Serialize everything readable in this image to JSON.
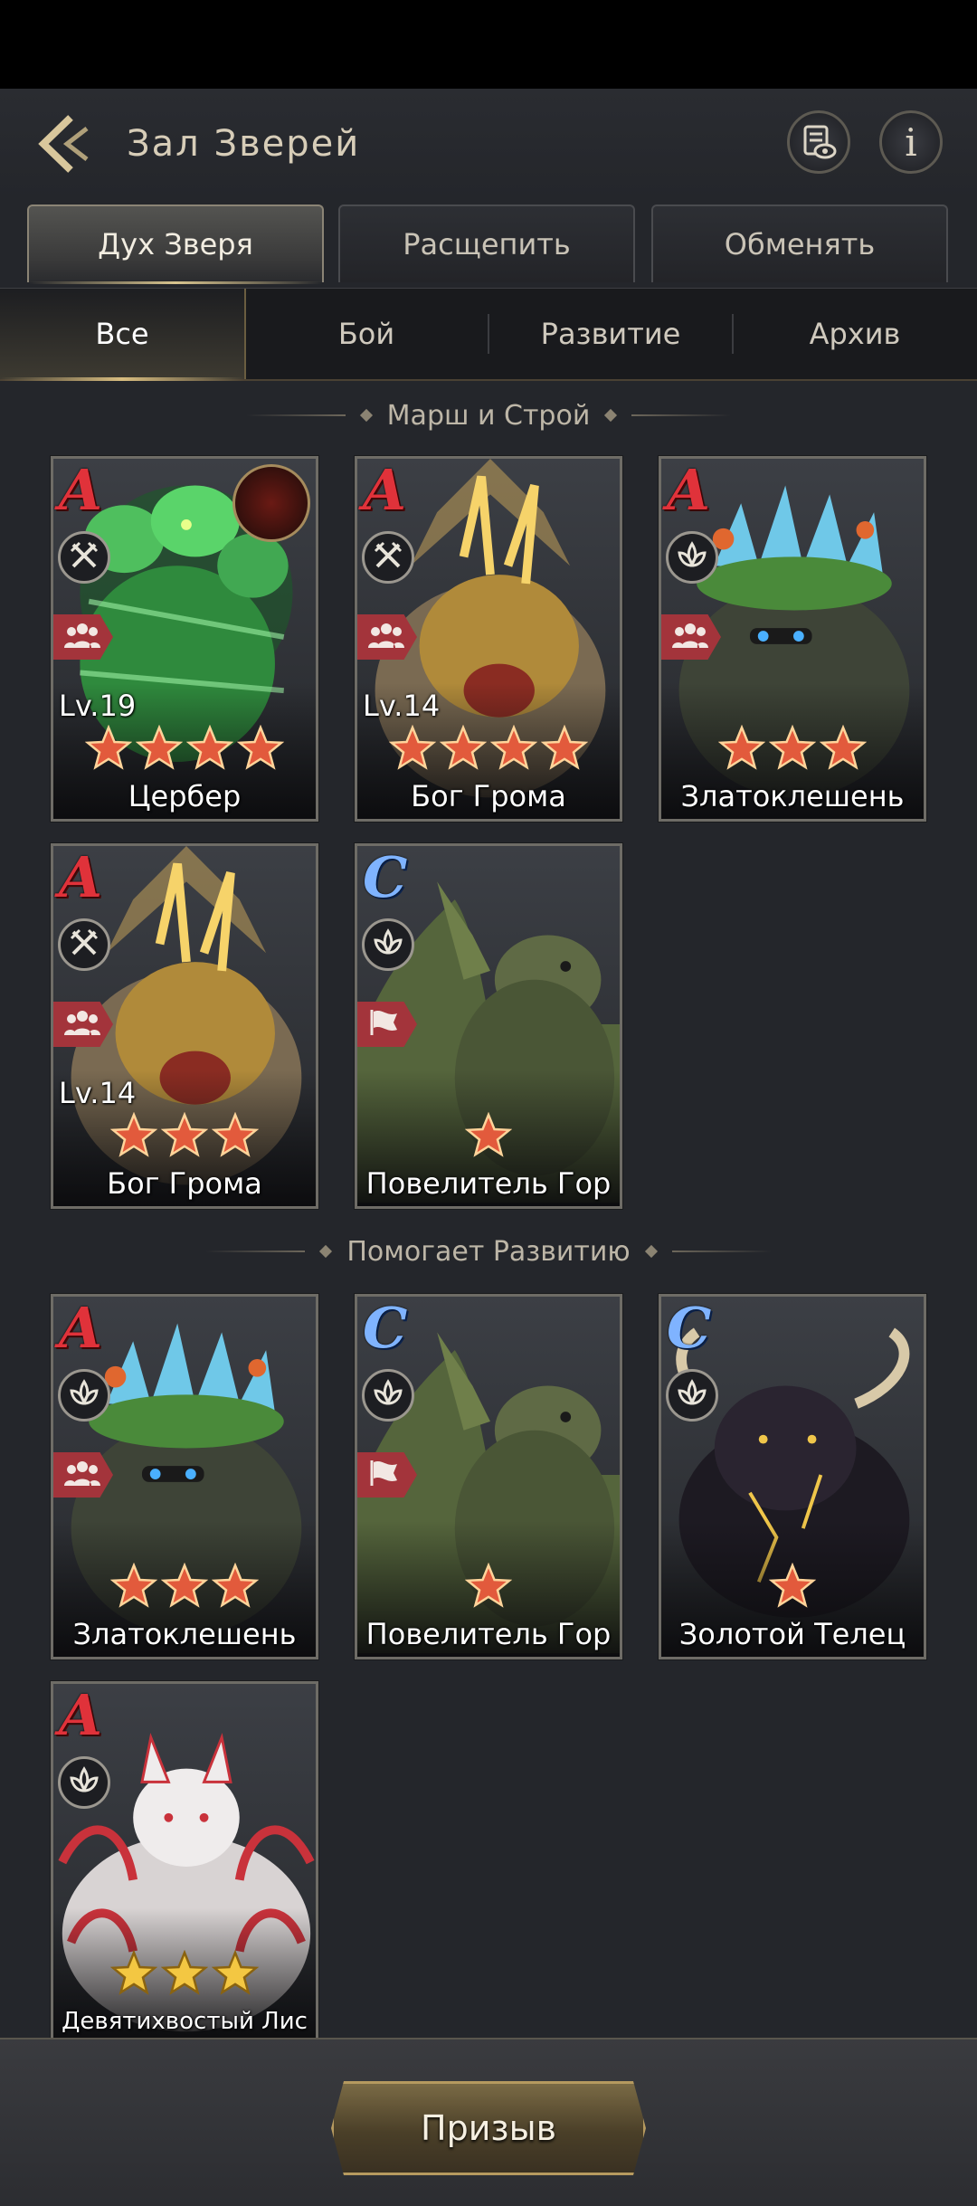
{
  "header": {
    "title": "Зал Зверей",
    "info_label": "i"
  },
  "tabs": [
    "Дух Зверя",
    "Расщепить",
    "Обменять"
  ],
  "subtabs": [
    "Все",
    "Бой",
    "Развитие",
    "Архив"
  ],
  "sections": [
    "Марш и Строй",
    "Помогает Развитию"
  ],
  "colors": {
    "rank_A": "#e0323a",
    "rank_C": "#7fb3ff",
    "accent_gold": "#b69a5f",
    "type_badge": "#a3343b"
  },
  "march_cards": [
    {
      "rank": "A",
      "level": "Lv.19",
      "stars": 4,
      "name": "Цербер",
      "class_icon": "crossed-swords-icon",
      "type_icon": "troop-group-icon",
      "art": "cerberus"
    },
    {
      "rank": "A",
      "level": "Lv.14",
      "stars": 4,
      "name": "Бог Грома",
      "class_icon": "crossed-swords-icon",
      "type_icon": "troop-group-icon",
      "art": "thunder"
    },
    {
      "rank": "A",
      "level": "",
      "stars": 3,
      "name": "Златоклешень",
      "class_icon": "lotus-icon",
      "type_icon": "troop-group-icon",
      "art": "crab"
    },
    {
      "rank": "A",
      "level": "Lv.14",
      "stars": 3,
      "name": "Бог Грома",
      "class_icon": "crossed-swords-icon",
      "type_icon": "troop-group-icon",
      "art": "thunder"
    },
    {
      "rank": "C",
      "level": "",
      "stars": 1,
      "name": "Повелитель Гор",
      "class_icon": "lotus-icon",
      "type_icon": "flag-icon",
      "art": "turtle"
    }
  ],
  "dev_cards": [
    {
      "rank": "A",
      "level": "",
      "stars": 3,
      "name": "Златоклешень",
      "class_icon": "lotus-icon",
      "type_icon": "troop-group-icon",
      "art": "crab"
    },
    {
      "rank": "C",
      "level": "",
      "stars": 1,
      "name": "Повелитель Гор",
      "class_icon": "lotus-icon",
      "type_icon": "flag-icon",
      "art": "turtle"
    },
    {
      "rank": "C",
      "level": "",
      "stars": 1,
      "name": "Золотой Телец",
      "class_icon": "lotus-icon",
      "type_icon": "",
      "art": "bull"
    },
    {
      "rank": "A",
      "level": "",
      "stars": 3,
      "name": "Девятихвостый Лис",
      "class_icon": "lotus-icon",
      "type_icon": "",
      "art": "fox",
      "star_style": "gold"
    }
  ],
  "summon_label": "Призыв"
}
